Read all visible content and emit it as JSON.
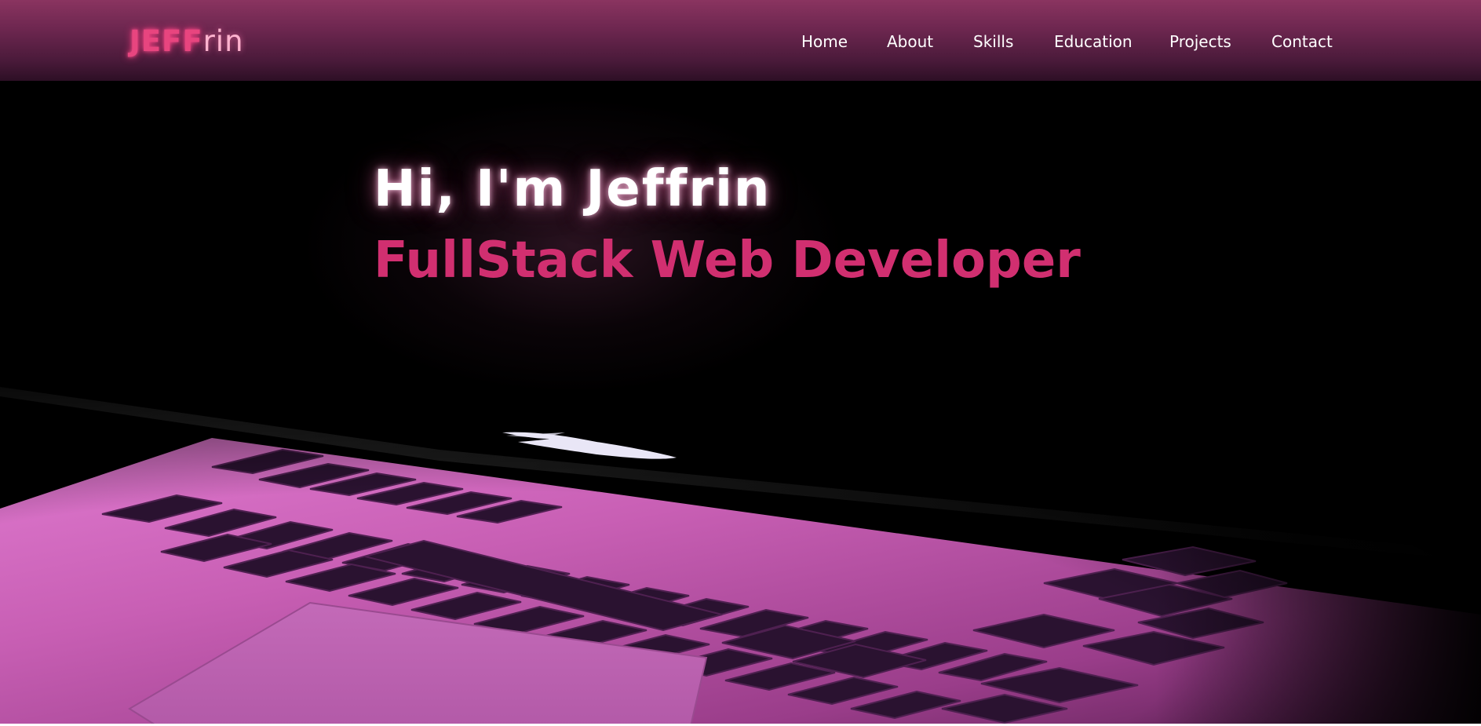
{
  "brand": {
    "logo_part1": "JEFF",
    "logo_part2": "rin"
  },
  "nav": {
    "items": [
      {
        "label": "Home"
      },
      {
        "label": "About"
      },
      {
        "label": "Skills"
      },
      {
        "label": "Education"
      },
      {
        "label": "Projects"
      },
      {
        "label": "Contact"
      }
    ]
  },
  "hero": {
    "greeting": "Hi, I'm Jeffrin",
    "role": "FullStack Web Developer"
  },
  "colors": {
    "accent": "#d12f70",
    "logo_primary": "#e8457f",
    "logo_secondary": "#ffb3cf",
    "nav_background": "#6e2750",
    "hero_background": "#000000",
    "laptop_glow": "#c85fb4"
  },
  "background_image": "laptop-keyboard-pink-glow"
}
